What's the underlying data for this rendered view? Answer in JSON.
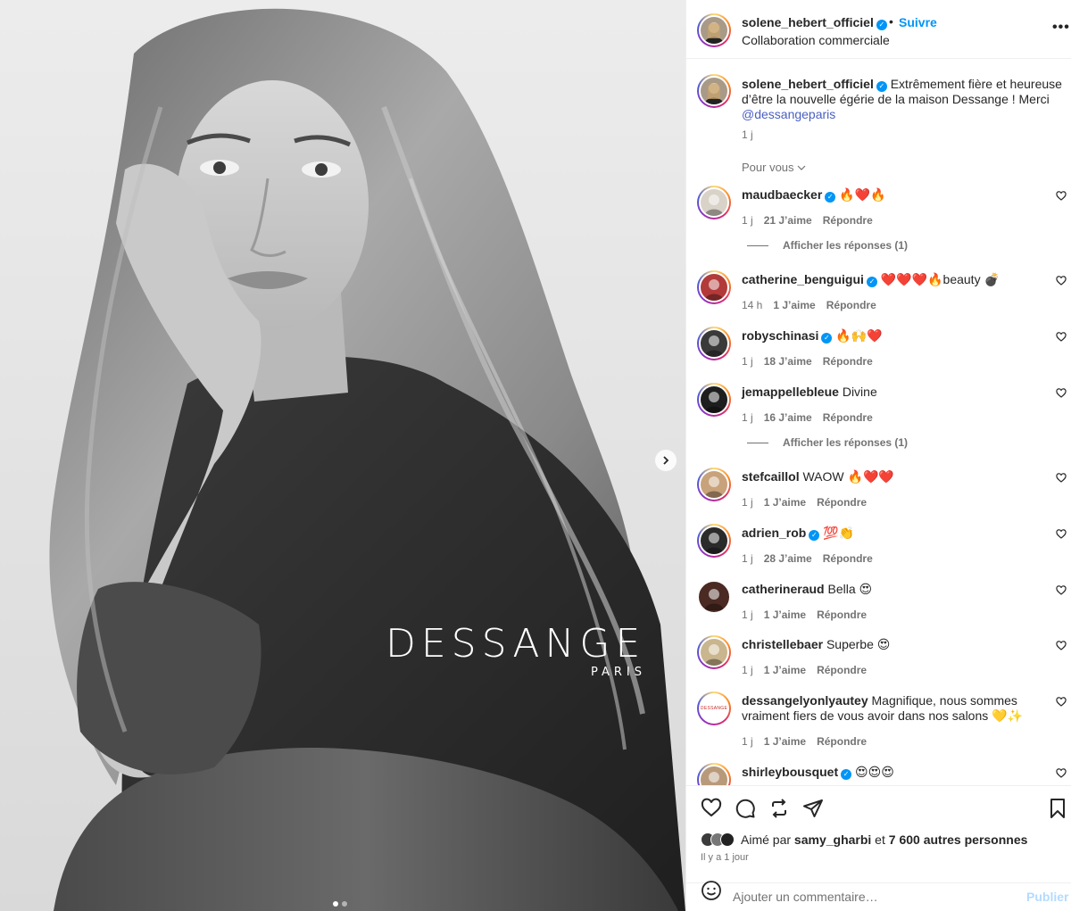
{
  "post": {
    "username": "solene_hebert_officiel",
    "follow_label": "Suivre",
    "separator": "•",
    "subtitle": "Collaboration commerciale",
    "more_label": "•••"
  },
  "media": {
    "brand_name": "DESSANGE",
    "brand_sub": "PARIS",
    "carousel_total": 2,
    "carousel_current": 1
  },
  "caption": {
    "username": "solene_hebert_officiel",
    "text": " Extrêmement fière et heureuse d’être la nouvelle égérie de la maison Dessange ! Merci ",
    "mention": "@dessangeparis",
    "time": "1 j"
  },
  "for_you_label": "Pour vous",
  "reply_label": "Répondre",
  "comments": [
    {
      "user": "maudbaecker",
      "verified": true,
      "text": " 🔥❤️🔥",
      "time": "1 j",
      "likes": "21 J’aime",
      "replies": "Afficher les réponses (1)"
    },
    {
      "user": "catherine_benguigui",
      "verified": true,
      "text": " ❤️❤️❤️🔥beauty 💣",
      "time": "14 h",
      "likes": "1 J’aime",
      "replies": ""
    },
    {
      "user": "robyschinasi",
      "verified": true,
      "text": " 🔥🙌❤️",
      "time": "1 j",
      "likes": "18 J’aime",
      "replies": ""
    },
    {
      "user": "jemappellebleue",
      "verified": false,
      "text": " Divine",
      "time": "1 j",
      "likes": "16 J’aime",
      "replies": "Afficher les réponses (1)"
    },
    {
      "user": "stefcaillol",
      "verified": false,
      "text": " WAOW 🔥❤️❤️",
      "time": "1 j",
      "likes": "1 J’aime",
      "replies": ""
    },
    {
      "user": "adrien_rob",
      "verified": true,
      "text": " 💯👏",
      "time": "1 j",
      "likes": "28 J’aime",
      "replies": ""
    },
    {
      "user": "catherineraud",
      "verified": false,
      "text": " Bella 😍",
      "time": "1 j",
      "likes": "1 J’aime",
      "replies": ""
    },
    {
      "user": "christellebaer",
      "verified": false,
      "text": " Superbe 😍",
      "time": "1 j",
      "likes": "1 J’aime",
      "replies": ""
    },
    {
      "user": "dessangelyonlyautey",
      "verified": false,
      "text": " Magnifique, nous sommes vraiment fiers de vous avoir dans nos salons 💛✨",
      "time": "1 j",
      "likes": "1 J’aime",
      "replies": "",
      "avatar_text": "DESSANGE"
    },
    {
      "user": "shirleybousquet",
      "verified": true,
      "text": " 😍😍😍",
      "time": "",
      "likes": "",
      "replies": ""
    }
  ],
  "likes": {
    "prefix": "Aimé par ",
    "user": "samy_gharbi",
    "middle": " et ",
    "count": "7 600 autres personnes"
  },
  "date": "Il y a 1 jour",
  "comment_box": {
    "placeholder": "Ajouter un commentaire…",
    "publish": "Publier"
  },
  "colors": {
    "accent": "#0095f6",
    "mention": "#4a5fc1",
    "muted": "#737373",
    "publish_disabled": "#b3dbff"
  },
  "icons": {
    "like": "heart-icon",
    "comment": "comment-icon",
    "repost": "repost-icon",
    "share": "send-icon",
    "save": "bookmark-icon",
    "emoji": "smiley-icon",
    "next": "chevron-right-icon",
    "verified": "verified-badge-icon"
  }
}
